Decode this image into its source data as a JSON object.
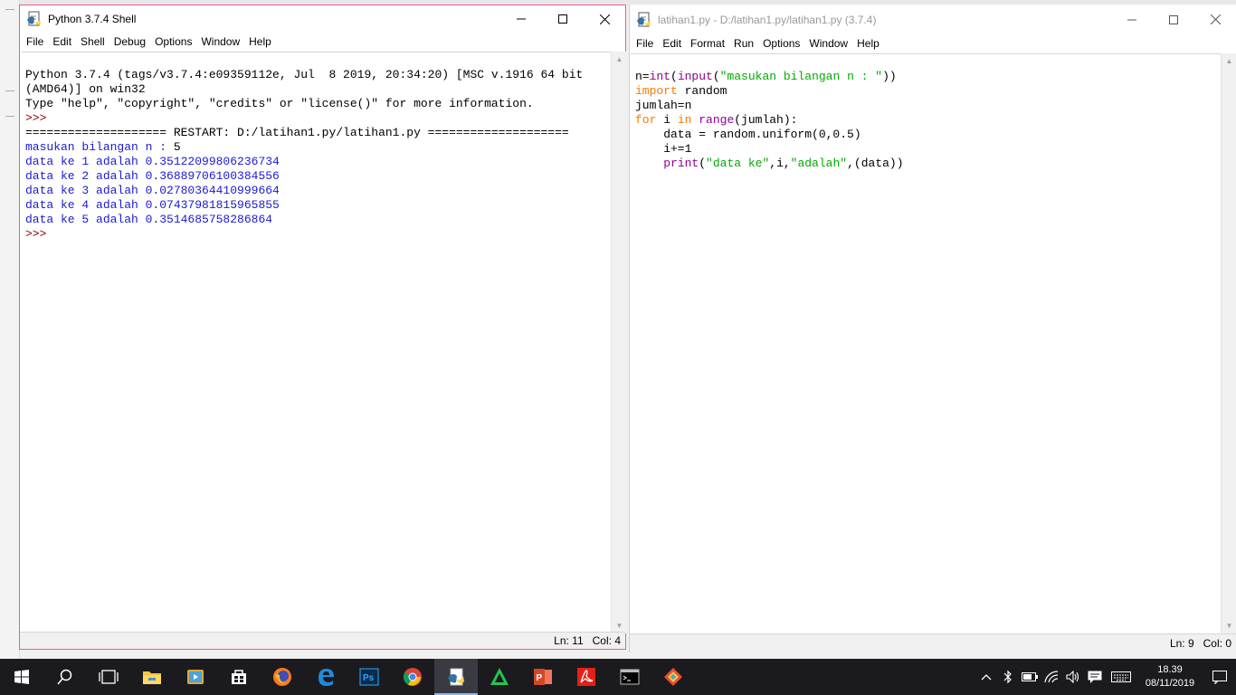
{
  "shell": {
    "title": "Python 3.7.4 Shell",
    "menu": [
      "File",
      "Edit",
      "Shell",
      "Debug",
      "Options",
      "Window",
      "Help"
    ],
    "output": {
      "banner_line1": "Python 3.7.4 (tags/v3.7.4:e09359112e, Jul  8 2019, 20:34:20) [MSC v.1916 64 bit",
      "banner_line2": "(AMD64)] on win32",
      "banner_line3": "Type \"help\", \"copyright\", \"credits\" or \"license()\" for more information.",
      "prompt1": ">>> ",
      "restart": "==================== RESTART: D:/latihan1.py/latihan1.py ====================",
      "input_prompt": "masukan bilangan n : ",
      "input_value": "5",
      "results": [
        "data ke 1 adalah 0.35122099806236734",
        "data ke 2 adalah 0.36889706100384556",
        "data ke 3 adalah 0.02780364410999664",
        "data ke 4 adalah 0.07437981815965855",
        "data ke 5 adalah 0.3514685758286864"
      ],
      "prompt2": ">>> "
    },
    "status": {
      "line": "Ln: 11",
      "col": "Col: 4"
    }
  },
  "editor": {
    "title": "latihan1.py - D:/latihan1.py/latihan1.py (3.7.4)",
    "menu": [
      "File",
      "Edit",
      "Format",
      "Run",
      "Options",
      "Window",
      "Help"
    ],
    "code": {
      "l1_var": "n=",
      "l1_int": "int",
      "l1_p1": "(",
      "l1_input": "input",
      "l1_p2": "(",
      "l1_str": "\"masukan bilangan n : \"",
      "l1_p3": "))",
      "l2_kw": "import",
      "l2_rest": " random",
      "l3": "jumlah=n",
      "l4_for": "for",
      "l4_i": " i ",
      "l4_in": "in",
      "l4_sp": " ",
      "l4_range": "range",
      "l4_rest": "(jumlah):",
      "l5": "    data = random.uniform(0,0.5)",
      "l6": "    i+=1",
      "l7_indent": "    ",
      "l7_print": "print",
      "l7_p1": "(",
      "l7_s1": "\"data ke\"",
      "l7_mid": ",i,",
      "l7_s2": "\"adalah\"",
      "l7_end": ",(data))"
    },
    "status": {
      "line": "Ln: 9",
      "col": "Col: 0"
    }
  },
  "taskbar": {
    "apps": [
      "start-icon",
      "search-icon",
      "task-view-icon",
      "file-explorer-icon",
      "media-player-icon",
      "store-icon",
      "firefox-icon",
      "edge-icon",
      "photoshop-icon",
      "chrome-icon",
      "python-idle-icon",
      "green-app-icon",
      "powerpoint-icon",
      "acrobat-icon",
      "terminal-icon",
      "git-icon"
    ],
    "clock_time": "18.39",
    "clock_date": "08/11/2019"
  },
  "colors": {
    "shell_border": "#e35fa0",
    "output_blue": "#1a1ad4",
    "prompt": "#8b0000",
    "keyword": "#ff7700",
    "builtin": "#900090",
    "string": "#00aa00",
    "taskbar": "#1b1b1f"
  }
}
